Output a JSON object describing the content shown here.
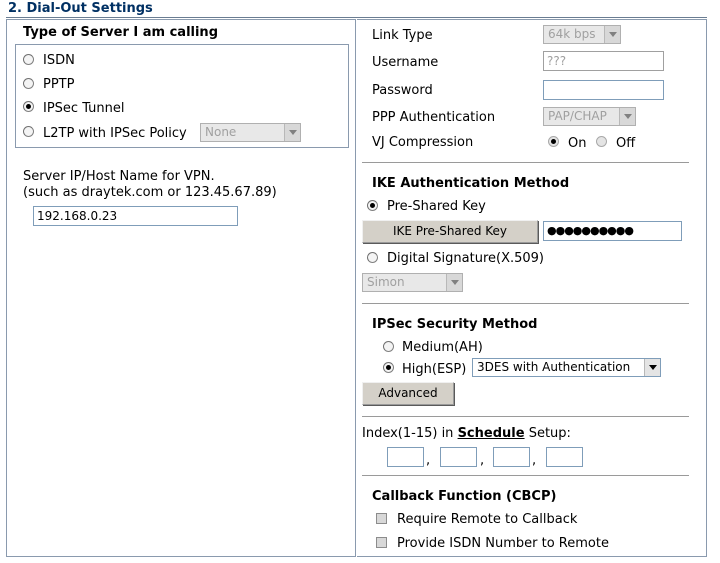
{
  "section": {
    "title": "2. Dial-Out Settings"
  },
  "server_type": {
    "legend": "Type of Server I am calling",
    "options": [
      {
        "label": "ISDN",
        "selected": false
      },
      {
        "label": "PPTP",
        "selected": false
      },
      {
        "label": "IPSec Tunnel",
        "selected": true
      },
      {
        "label": "L2TP with IPSec Policy",
        "selected": false
      }
    ],
    "l2tp_policy_value": "None"
  },
  "server_host": {
    "label_line1": "Server IP/Host Name for VPN.",
    "label_line2": "(such as draytek.com or 123.45.67.89)",
    "value": "192.168.0.23"
  },
  "link_type": {
    "label": "Link Type",
    "value": "64k bps"
  },
  "username": {
    "label": "Username",
    "value": "???"
  },
  "password": {
    "label": "Password",
    "value": ""
  },
  "ppp_auth": {
    "label": "PPP Authentication",
    "value": "PAP/CHAP"
  },
  "vj_compression": {
    "label": "VJ Compression",
    "on_label": "On",
    "off_label": "Off",
    "selected": "On"
  },
  "ike": {
    "heading": "IKE Authentication Method",
    "preshared_label": "Pre-Shared Key",
    "preshared_selected": true,
    "preshared_button": "IKE Pre-Shared Key",
    "preshared_value": "●●●●●●●●●●",
    "digital_sig_label": "Digital Signature(X.509)",
    "digital_sig_selected": false,
    "cert_value": "Simon"
  },
  "ipsec": {
    "heading": "IPSec Security Method",
    "medium_label": "Medium(AH)",
    "high_label": "High(ESP)",
    "selected": "High(ESP)",
    "high_value": "3DES with Authentication",
    "advanced_button": "Advanced"
  },
  "schedule": {
    "prefix": "Index(1-15) in",
    "link": "Schedule",
    "suffix": "Setup:",
    "separator": ",",
    "indexes": [
      "",
      "",
      "",
      ""
    ]
  },
  "callback": {
    "heading": "Callback Function (CBCP)",
    "require_label": "Require Remote to Callback",
    "provide_label": "Provide ISDN Number to Remote"
  }
}
